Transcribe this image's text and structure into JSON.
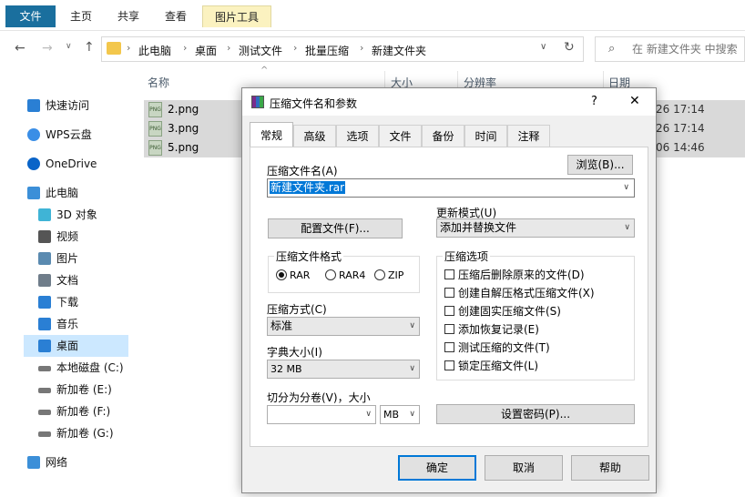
{
  "ribbon": {
    "tabs": [
      "文件",
      "主页",
      "共享",
      "查看",
      "图片工具"
    ]
  },
  "address": {
    "crumbs": [
      "此电脑",
      "桌面",
      "测试文件",
      "批量压缩",
      "新建文件夹"
    ],
    "search_placeholder": "在 新建文件夹 中搜索"
  },
  "sidebar": [
    {
      "label": "快速访问",
      "icon": "star-icon"
    },
    {
      "label": "WPS云盘",
      "icon": "cloud-icon"
    },
    {
      "label": "OneDrive",
      "icon": "onedrive-icon"
    },
    {
      "label": "此电脑",
      "icon": "computer-icon"
    },
    {
      "label": "3D 对象",
      "icon": "cube-icon"
    },
    {
      "label": "视频",
      "icon": "video-icon"
    },
    {
      "label": "图片",
      "icon": "picture-icon"
    },
    {
      "label": "文档",
      "icon": "document-icon"
    },
    {
      "label": "下载",
      "icon": "download-icon"
    },
    {
      "label": "音乐",
      "icon": "music-icon"
    },
    {
      "label": "桌面",
      "icon": "desktop-icon"
    },
    {
      "label": "本地磁盘 (C:)",
      "icon": "drive-icon"
    },
    {
      "label": "新加卷 (E:)",
      "icon": "drive-icon"
    },
    {
      "label": "新加卷 (F:)",
      "icon": "drive-icon"
    },
    {
      "label": "新加卷 (G:)",
      "icon": "drive-icon"
    },
    {
      "label": "网络",
      "icon": "network-icon"
    }
  ],
  "filelist": {
    "columns": [
      "名称",
      "大小",
      "分辨率",
      "日期"
    ],
    "files": [
      {
        "name": "2.png",
        "date": "26 17:14"
      },
      {
        "name": "3.png",
        "date": "26 17:14"
      },
      {
        "name": "5.png",
        "date": "06 14:46"
      }
    ]
  },
  "dialog": {
    "title": "压缩文件名和参数",
    "help_glyph": "?",
    "close_glyph": "✕",
    "tabs": [
      "常规",
      "高级",
      "选项",
      "文件",
      "备份",
      "时间",
      "注释"
    ],
    "archive_name_label": "压缩文件名(A)",
    "archive_name_value": "新建文件夹.rar",
    "browse_button": "浏览(B)...",
    "profile_button": "配置文件(F)...",
    "update_mode_label": "更新模式(U)",
    "update_mode_value": "添加并替换文件",
    "format_group": "压缩文件格式",
    "formats": [
      "RAR",
      "RAR4",
      "ZIP"
    ],
    "selected_format": "RAR",
    "method_label": "压缩方式(C)",
    "method_value": "标准",
    "dict_label": "字典大小(I)",
    "dict_value": "32 MB",
    "split_label": "切分为分卷(V)，大小",
    "split_unit": "MB",
    "options_group": "压缩选项",
    "options": [
      "压缩后删除原来的文件(D)",
      "创建自解压格式压缩文件(X)",
      "创建固实压缩文件(S)",
      "添加恢复记录(E)",
      "测试压缩的文件(T)",
      "锁定压缩文件(L)"
    ],
    "password_button": "设置密码(P)...",
    "ok_button": "确定",
    "cancel_button": "取消",
    "help_button": "帮助"
  }
}
